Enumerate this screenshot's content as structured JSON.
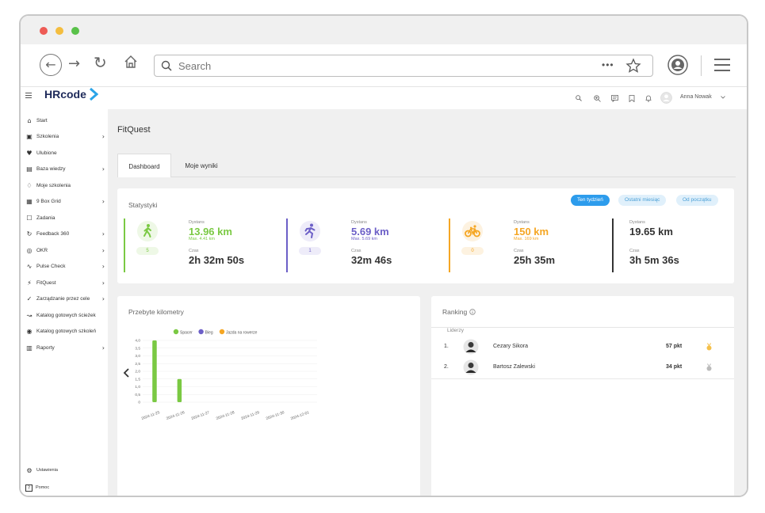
{
  "browser": {
    "search_placeholder": "Search",
    "more_label": "•••"
  },
  "app": {
    "logo": "HRcode",
    "user_name": "Anna Nowak"
  },
  "sidebar": {
    "items": [
      {
        "label": "Start",
        "icon": "home-icon",
        "chevron": false
      },
      {
        "label": "Szkolenia",
        "icon": "play-icon",
        "chevron": true
      },
      {
        "label": "Ulubione",
        "icon": "heart-icon",
        "chevron": false
      },
      {
        "label": "Baza wiedzy",
        "icon": "book-icon",
        "chevron": true
      },
      {
        "label": "Moje szkolenia",
        "icon": "cap-icon",
        "chevron": false
      },
      {
        "label": "9 Box Grid",
        "icon": "grid-icon",
        "chevron": true
      },
      {
        "label": "Zadania",
        "icon": "task-icon",
        "chevron": false
      },
      {
        "label": "Feedback 360",
        "icon": "cycle-icon",
        "chevron": true
      },
      {
        "label": "OKR",
        "icon": "target-icon",
        "chevron": true
      },
      {
        "label": "Pulse Check",
        "icon": "pulse-icon",
        "chevron": true
      },
      {
        "label": "FitQuest",
        "icon": "runner-icon",
        "chevron": true
      },
      {
        "label": "Zarządzanie przez cele",
        "icon": "check-circle-icon",
        "chevron": true
      },
      {
        "label": "Katalog gotowych ścieżek",
        "icon": "path-icon",
        "chevron": false
      },
      {
        "label": "Katalog gotowych szkoleń",
        "icon": "play-circle-icon",
        "chevron": false
      },
      {
        "label": "Raporty",
        "icon": "chart-icon",
        "chevron": true
      }
    ],
    "settings_label": "Ustawienia",
    "help_label": "Pomoc"
  },
  "page": {
    "title": "FitQuest",
    "tabs": [
      {
        "label": "Dashboard",
        "active": true
      },
      {
        "label": "Moje wyniki",
        "active": false
      }
    ]
  },
  "stats": {
    "title": "Statystyki",
    "period_buttons": [
      {
        "label": "Ten tydzień",
        "active": true
      },
      {
        "label": "Ostatni miesiąc",
        "active": false
      },
      {
        "label": "Od początku",
        "active": false
      }
    ],
    "columns": [
      {
        "icon": "walk-icon",
        "color": "#7ac943",
        "count": "5",
        "distance_label": "Dystans",
        "distance": "13.96 km",
        "max": "Max. 4.41 km",
        "time_label": "Czas",
        "time": "2h 32m 50s"
      },
      {
        "icon": "run-icon",
        "color": "#6c5fc7",
        "count": "1",
        "distance_label": "Dystans",
        "distance": "5.69 km",
        "max": "Max. 5.69 km",
        "time_label": "Czas",
        "time": "32m 46s"
      },
      {
        "icon": "bike-icon",
        "color": "#f5a623",
        "count": "0",
        "distance_label": "Dystans",
        "distance": "150 km",
        "max": "Max. 169 km",
        "time_label": "Czas",
        "time": "25h 35m"
      },
      {
        "icon": "",
        "color": "#333333",
        "count": "",
        "distance_label": "Dystans",
        "distance": "19.65 km",
        "max": "",
        "time_label": "Czas",
        "time": "3h 5m 36s"
      }
    ]
  },
  "km_card": {
    "title": "Przebyte kilometry"
  },
  "chart_data": {
    "type": "bar",
    "categories": [
      "2024-11-25",
      "2024-11-26",
      "2024-11-27",
      "2024-11-28",
      "2024-11-29",
      "2024-11-30",
      "2024-12-01"
    ],
    "series": [
      {
        "name": "Spacer",
        "color": "#7ac943",
        "values": [
          4.0,
          1.5,
          0,
          0,
          0,
          0,
          0
        ]
      },
      {
        "name": "Bieg",
        "color": "#6c5fc7",
        "values": [
          0,
          0,
          0,
          0,
          0,
          0,
          0
        ]
      },
      {
        "name": "Jazda na rowerze",
        "color": "#f5a623",
        "values": [
          0,
          0,
          0,
          0,
          0,
          0,
          0
        ]
      }
    ],
    "yticks": [
      "4,0",
      "3,5",
      "3,0",
      "2,5",
      "2,0",
      "1,5",
      "1,0",
      "0,5",
      "0"
    ],
    "ylim": [
      0,
      4
    ],
    "legend": "top"
  },
  "ranking": {
    "title": "Ranking",
    "subtitle": "Liderzy",
    "rows": [
      {
        "rank": "1.",
        "name": "Cezary Sikora",
        "points": "57 pkt",
        "medal_color": "#f5c04a"
      },
      {
        "rank": "2.",
        "name": "Bartosz Zalewski",
        "points": "34 pkt",
        "medal_color": "#bbbbbb"
      }
    ]
  }
}
